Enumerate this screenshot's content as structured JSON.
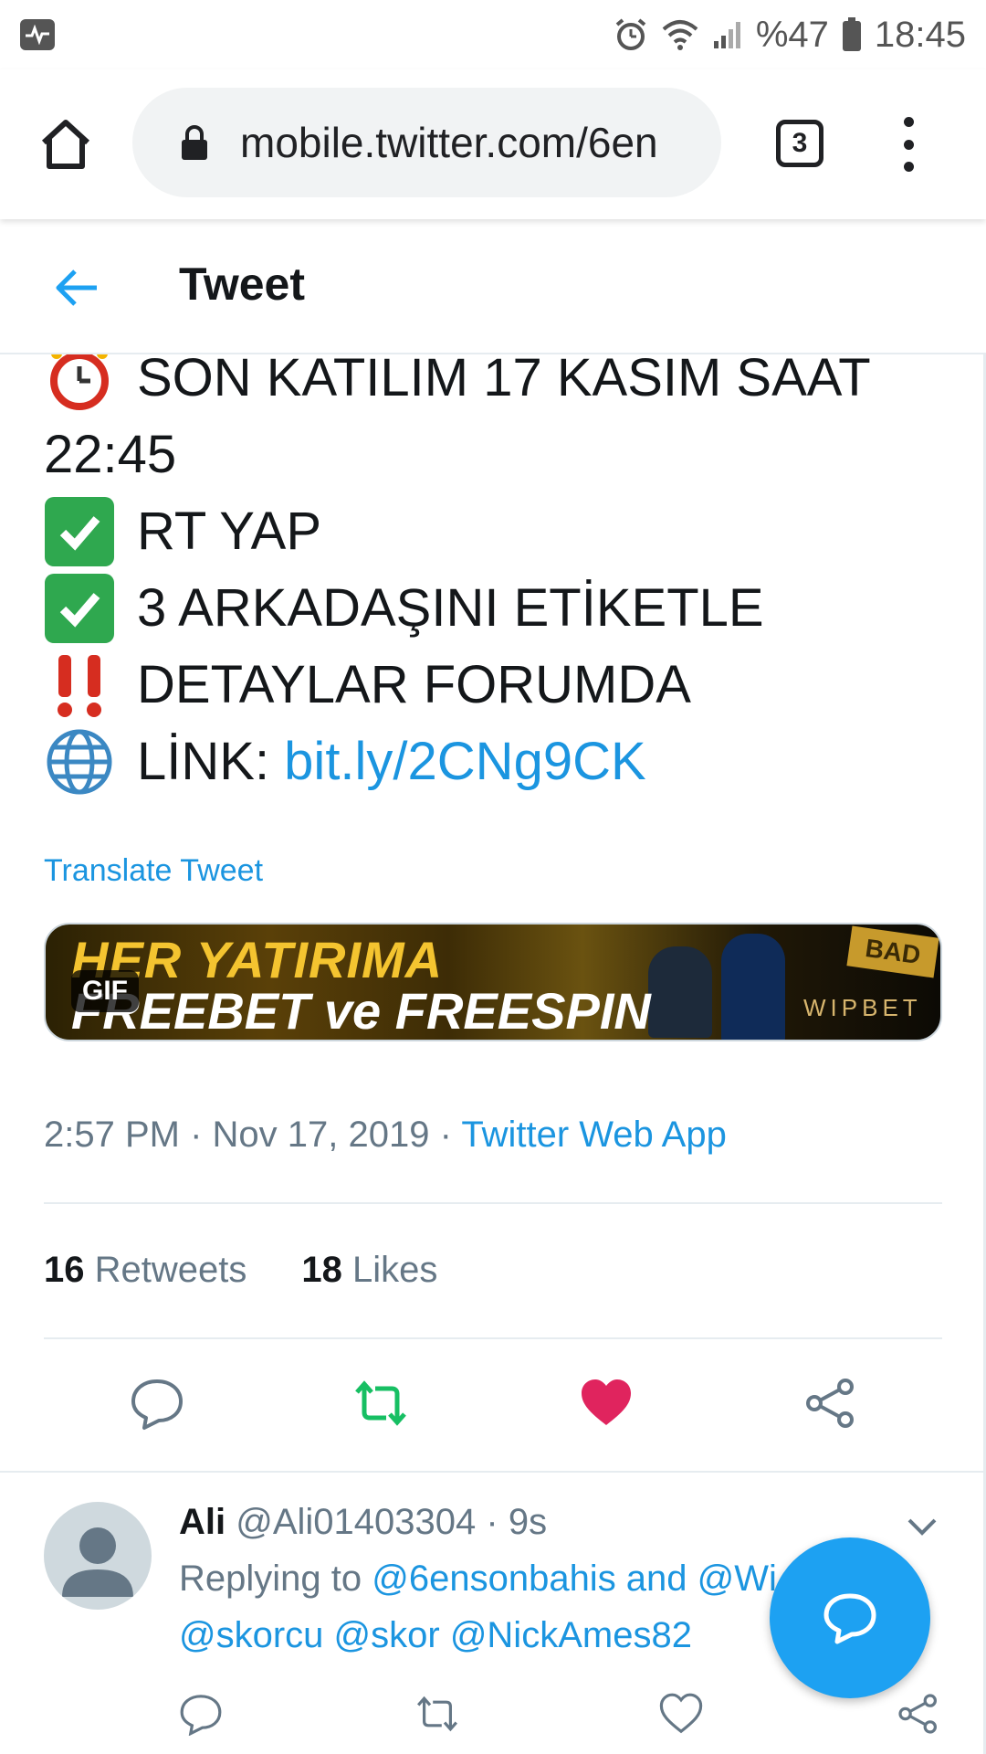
{
  "status_bar": {
    "battery": "%47",
    "time": "18:45"
  },
  "browser": {
    "url": "mobile.twitter.com/6en",
    "tab_count": "3"
  },
  "header": {
    "title": "Tweet"
  },
  "tweet": {
    "lines": [
      {
        "icon": "alarm-clock-emoji",
        "text": "SON KATILIM 17 KASIM SAAT"
      },
      {
        "icon": "",
        "text": "22:45"
      },
      {
        "icon": "check-mark-emoji",
        "text": "RT YAP"
      },
      {
        "icon": "check-mark-emoji",
        "text": "3 ARKADAŞINI ETİKETLE"
      },
      {
        "icon": "double-exclamation-emoji",
        "text": "DETAYLAR FORUMDA"
      },
      {
        "icon": "globe-emoji",
        "text": "LİNK: ",
        "link": "bit.ly/2CNg9CK"
      }
    ],
    "translate_label": "Translate Tweet",
    "media": {
      "line1": "HER YATIRIMA",
      "line2": "FREEBET ve FREESPIN",
      "gif_badge": "GIF",
      "brand": "WIPBET",
      "corner_badge": "BAD"
    },
    "time": "2:57 PM",
    "date": "Nov 17, 2019",
    "separator": "·",
    "source": "Twitter Web App",
    "retweets_count": "16",
    "retweets_label": "Retweets",
    "likes_count": "18",
    "likes_label": "Likes",
    "colors": {
      "retweet": "#17bf63",
      "like": "#e0245e",
      "link": "#1b95e0"
    }
  },
  "reply": {
    "name": "Ali",
    "handle": "@Ali01403304",
    "age": "· 9s",
    "replying_prefix": "Replying to ",
    "replying_mentions_line1": "@6ensonbahis and @Wi",
    "replying_mentions_line2": "@skorcu @skor @NickAmes82"
  }
}
